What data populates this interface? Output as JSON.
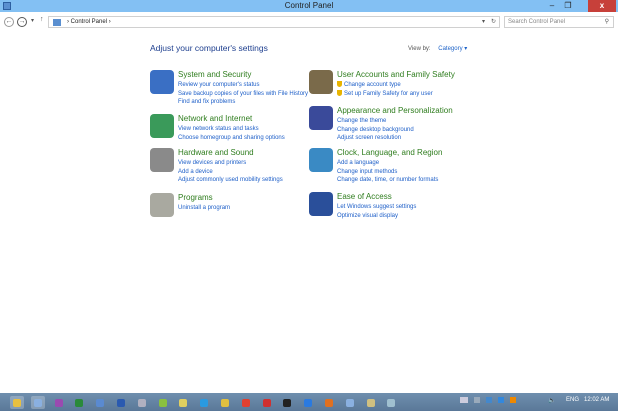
{
  "window": {
    "title": "Control Panel",
    "minimize": "–",
    "restore": "❐",
    "close": "x"
  },
  "address": {
    "path": "Control Panel",
    "separator": "›",
    "search_placeholder": "Search Control Panel"
  },
  "main": {
    "heading": "Adjust your computer's settings",
    "view_by_label": "View by:",
    "view_by_value": "Category ▾"
  },
  "categories": [
    {
      "title": "System and Security",
      "links": [
        "Review your computer's status",
        "Save backup copies of your files with File History",
        "Find and fix problems"
      ],
      "color": "#3a6fc4"
    },
    {
      "title": "Network and Internet",
      "links": [
        "View network status and tasks",
        "Choose homegroup and sharing options"
      ],
      "color": "#3a9a5a"
    },
    {
      "title": "Hardware and Sound",
      "links": [
        "View devices and printers",
        "Add a device",
        "Adjust commonly used mobility settings"
      ],
      "color": "#8a8a8a"
    },
    {
      "title": "Programs",
      "links": [
        "Uninstall a program"
      ],
      "color": "#a9a9a0"
    },
    {
      "title": "User Accounts and Family Safety",
      "links": [
        "Change account type",
        "Set up Family Safety for any user"
      ],
      "color": "#7a6a4a"
    },
    {
      "title": "Appearance and Personalization",
      "links": [
        "Change the theme",
        "Change desktop background",
        "Adjust screen resolution"
      ],
      "color": "#3a4a9a"
    },
    {
      "title": "Clock, Language, and Region",
      "links": [
        "Add a language",
        "Change input methods",
        "Change date, time, or number formats"
      ],
      "color": "#3a8ac4"
    },
    {
      "title": "Ease of Access",
      "links": [
        "Let Windows suggest settings",
        "Optimize visual display"
      ],
      "color": "#2a4f9a"
    }
  ],
  "taskbar": {
    "icons": [
      "file-explorer",
      "control-panel",
      "visual-studio",
      "utorrent",
      "app-circle",
      "outlook",
      "app-gear",
      "app-green",
      "app-yellow",
      "skype",
      "python",
      "chrome",
      "app-red",
      "terminal",
      "teamviewer",
      "vlc",
      "app-window",
      "app-puzzle",
      "app-tablet"
    ],
    "icon_colors": [
      "#e8c040",
      "#8ab0e0",
      "#9a4ab0",
      "#2a8a3a",
      "#5a8ad0",
      "#2a5ab0",
      "#b0b0c0",
      "#8ac040",
      "#e0d060",
      "#2a9ae0",
      "#e0c040",
      "#e04030",
      "#d03030",
      "#222",
      "#2a7ae0",
      "#e07020",
      "#8ab0e0",
      "#d0c080",
      "#a0c0d0"
    ],
    "language": "ENG",
    "time": "12:02 AM"
  }
}
